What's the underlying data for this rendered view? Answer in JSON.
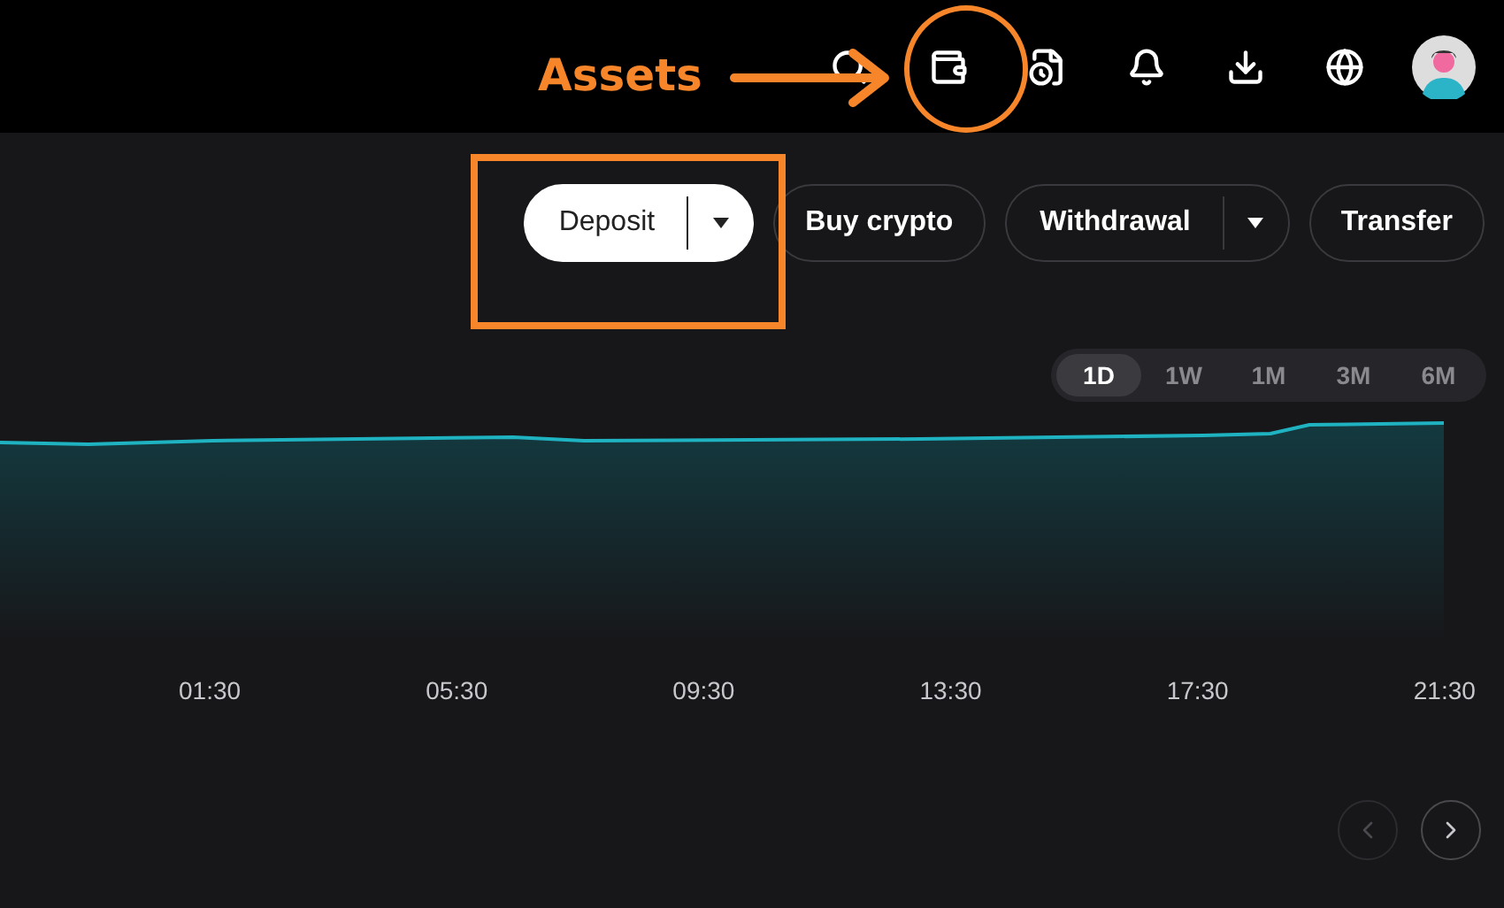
{
  "annotation": {
    "label": "Assets"
  },
  "actions": [
    {
      "label": "Deposit",
      "kind": "split",
      "primary": true
    },
    {
      "label": "Buy crypto",
      "kind": "plain",
      "primary": false
    },
    {
      "label": "Withdrawal",
      "kind": "split",
      "primary": false
    },
    {
      "label": "Transfer",
      "kind": "plain",
      "primary": false
    }
  ],
  "periods": [
    {
      "label": "1D",
      "selected": true
    },
    {
      "label": "1W",
      "selected": false
    },
    {
      "label": "1M",
      "selected": false
    },
    {
      "label": "3M",
      "selected": false
    },
    {
      "label": "6M",
      "selected": false
    }
  ],
  "chart": {
    "x_labels": [
      "01:30",
      "05:30",
      "09:30",
      "13:30",
      "17:30",
      "21:30"
    ]
  },
  "pager": {
    "prev_disabled": true,
    "next_disabled": false
  }
}
